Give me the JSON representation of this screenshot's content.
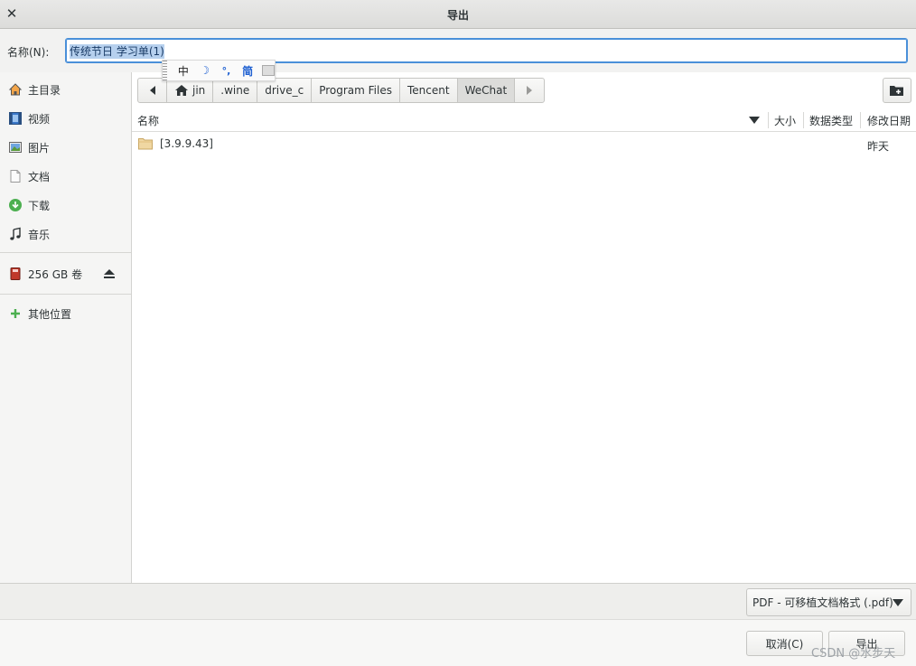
{
  "window": {
    "title": "导出"
  },
  "name_field": {
    "label": "名称(N):",
    "value": "传统节日 学习单(1)"
  },
  "ime_bar": {
    "mode": "中",
    "simplified": "简"
  },
  "sidebar": {
    "places": [
      {
        "label": "主目录",
        "icon": "home-icon"
      },
      {
        "label": "视频",
        "icon": "video-icon"
      },
      {
        "label": "图片",
        "icon": "pictures-icon"
      },
      {
        "label": "文档",
        "icon": "document-icon"
      },
      {
        "label": "下载",
        "icon": "download-icon"
      },
      {
        "label": "音乐",
        "icon": "music-icon"
      }
    ],
    "volume": {
      "label": "256 GB 卷",
      "icon": "drive-icon"
    },
    "other": {
      "label": "其他位置",
      "icon": "plus-icon"
    }
  },
  "pathbar": {
    "segments": [
      "jin",
      ".wine",
      "drive_c",
      "Program Files",
      "Tencent",
      "WeChat"
    ],
    "active_segment": "WeChat"
  },
  "columns": {
    "name": "名称",
    "size": "大小",
    "type": "数据类型",
    "modified": "修改日期"
  },
  "files": [
    {
      "name": "[3.9.9.43]",
      "size": "",
      "type": "",
      "modified": "昨天",
      "icon": "folder-icon"
    }
  ],
  "filter": {
    "selected": "PDF - 可移植文档格式 (.pdf)"
  },
  "buttons": {
    "cancel": "取消(C)",
    "export": "导出"
  },
  "watermark": "CSDN @水步天",
  "colors": {
    "accent": "#4a90d9",
    "selection": "#b6d0ee",
    "folder": "#f0d7a2"
  }
}
